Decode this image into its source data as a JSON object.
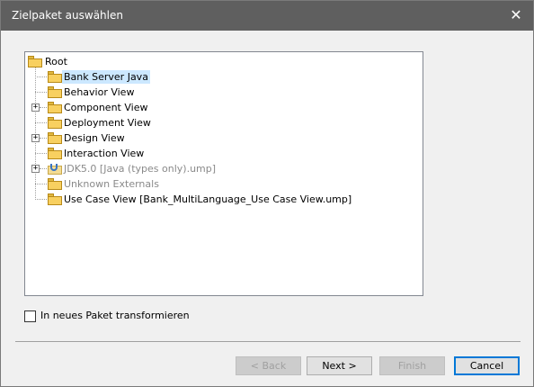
{
  "window": {
    "title": "Zielpaket auswählen",
    "close_glyph": "✕"
  },
  "tree": {
    "root_label": "Root",
    "items": [
      {
        "label": "Bank Server Java",
        "selected": true,
        "expandable": false,
        "disabled": false,
        "icon": "folder-icon"
      },
      {
        "label": "Behavior View",
        "selected": false,
        "expandable": false,
        "disabled": false,
        "icon": "folder-icon"
      },
      {
        "label": "Component View",
        "selected": false,
        "expandable": true,
        "disabled": false,
        "icon": "folder-icon"
      },
      {
        "label": "Deployment View",
        "selected": false,
        "expandable": false,
        "disabled": false,
        "icon": "folder-icon"
      },
      {
        "label": "Design View",
        "selected": false,
        "expandable": true,
        "disabled": false,
        "icon": "folder-icon"
      },
      {
        "label": "Interaction View",
        "selected": false,
        "expandable": false,
        "disabled": false,
        "icon": "folder-icon"
      },
      {
        "label": "JDK5.0 [Java (types only).ump]",
        "selected": false,
        "expandable": true,
        "disabled": true,
        "icon": "java-package-icon"
      },
      {
        "label": "Unknown Externals",
        "selected": false,
        "expandable": false,
        "disabled": true,
        "icon": "folder-icon"
      },
      {
        "label": "Use Case View [Bank_MultiLanguage_Use Case View.ump]",
        "selected": false,
        "expandable": false,
        "disabled": false,
        "icon": "folder-icon"
      }
    ],
    "expand_glyph": "+"
  },
  "options": {
    "transform_checkbox_label": "In neues Paket transformieren",
    "transform_checked": false
  },
  "buttons": {
    "back": "< Back",
    "next": "Next >",
    "finish": "Finish",
    "cancel": "Cancel"
  },
  "colors": {
    "titlebar": "#5f5f5f",
    "selection": "#cce8ff",
    "primary_button_border": "#0078d7"
  }
}
